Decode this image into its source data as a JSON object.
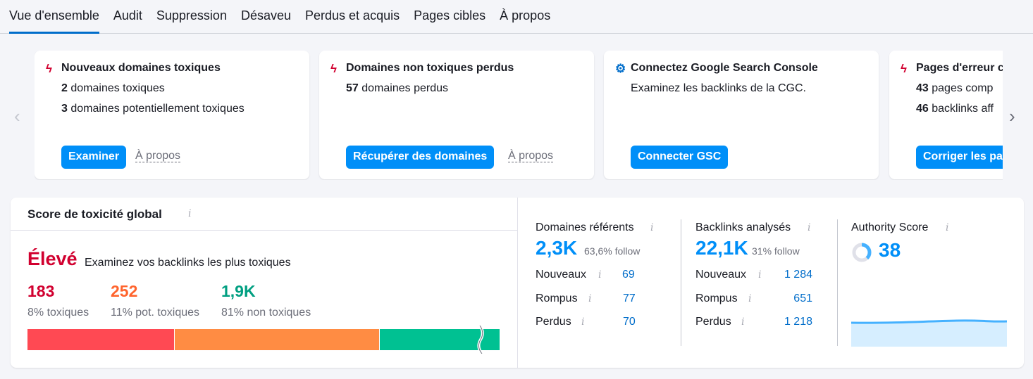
{
  "tabs": [
    "Vue d'ensemble",
    "Audit",
    "Suppression",
    "Désaveu",
    "Perdus et acquis",
    "Pages cibles",
    "À propos"
  ],
  "cards": [
    {
      "icon": "lightning-icon",
      "title": "Nouveaux domaines toxiques",
      "lines": [
        {
          "num": "2",
          "text": "domaines toxiques"
        },
        {
          "num": "3",
          "text": "domaines potentiellement toxiques"
        }
      ],
      "button": "Examiner",
      "about": "À propos"
    },
    {
      "icon": "lightning-icon",
      "title": "Domaines non toxiques perdus",
      "lines": [
        {
          "num": "57",
          "text": "domaines perdus"
        }
      ],
      "button": "Récupérer des domaines",
      "about": "À propos"
    },
    {
      "icon": "gear-icon",
      "title": "Connectez Google Search Console",
      "lines": [
        {
          "num": "",
          "text": "Examinez les backlinks de la CGC."
        }
      ],
      "button": "Connecter GSC"
    },
    {
      "icon": "lightning-icon",
      "title": "Pages d'erreur c",
      "lines": [
        {
          "num": "43",
          "text": "pages comp"
        },
        {
          "num": "46",
          "text": "backlinks aff"
        }
      ],
      "button": "Corriger les pa"
    }
  ],
  "toxicity": {
    "title": "Score de toxicité global",
    "level": "Élevé",
    "level_text": "Examinez vos backlinks les plus toxiques",
    "stats": [
      {
        "value": "183",
        "label": "8% toxiques",
        "color": "#d1002f"
      },
      {
        "value": "252",
        "label": "11% pot. toxiques",
        "color": "#ff642d"
      },
      {
        "value": "1,9K",
        "label": "81% non toxiques",
        "color": "#009f81"
      }
    ],
    "bar": [
      {
        "percent": 31,
        "color": "#ff4953"
      },
      {
        "percent": 43.5,
        "color": "#ff8c43"
      },
      {
        "percent": 25.5,
        "color": "#00c192"
      }
    ]
  },
  "referring": {
    "title": "Domaines référents",
    "value": "2,3K",
    "follow": "63,6% follow",
    "rows": [
      {
        "label": "Nouveaux",
        "value": "69"
      },
      {
        "label": "Rompus",
        "value": "77"
      },
      {
        "label": "Perdus",
        "value": "70"
      }
    ]
  },
  "backlinks": {
    "title": "Backlinks analysés",
    "value": "22,1K",
    "follow": "31% follow",
    "rows": [
      {
        "label": "Nouveaux",
        "value": "1 284"
      },
      {
        "label": "Rompus",
        "value": "651"
      },
      {
        "label": "Perdus",
        "value": "1 218"
      }
    ]
  },
  "authority": {
    "title": "Authority Score",
    "value": "38",
    "max": 100
  }
}
